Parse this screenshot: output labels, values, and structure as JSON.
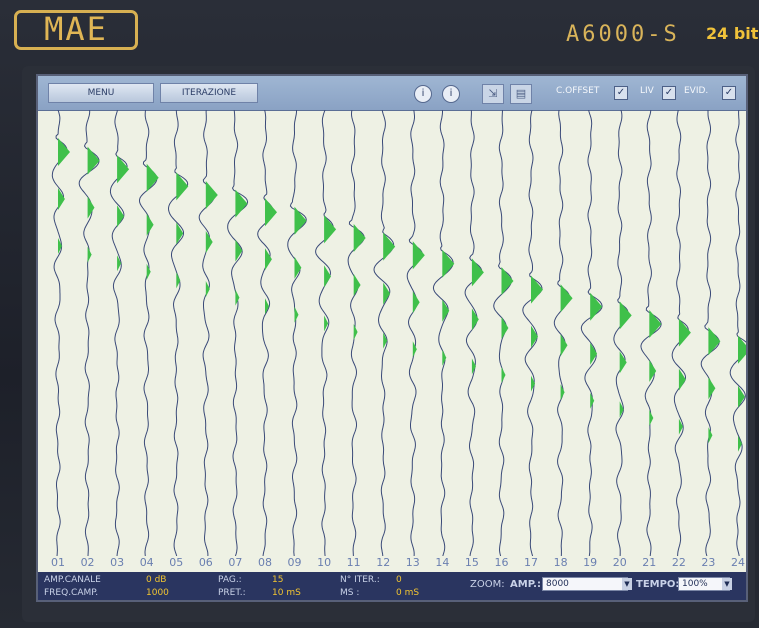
{
  "device": {
    "brand": "MAE",
    "model": "A6000-S",
    "bits": "24 bit"
  },
  "toolbar": {
    "menu_label": "MENU",
    "iterazione_label": "ITERAZIONE",
    "c_offset_label": "C.OFFSET",
    "liv_label": "LIV",
    "evid_label": "EVID."
  },
  "channels": [
    "01",
    "02",
    "03",
    "04",
    "05",
    "06",
    "07",
    "08",
    "09",
    "10",
    "11",
    "12",
    "13",
    "14",
    "15",
    "16",
    "17",
    "18",
    "19",
    "20",
    "21",
    "22",
    "23",
    "24"
  ],
  "status": {
    "amp_canale_label": "AMP.CANALE",
    "amp_canale_value": "0 dB",
    "freq_camp_label": "FREQ.CAMP.",
    "freq_camp_value": "1000",
    "pag_label": "PAG.:",
    "pag_value": "15",
    "pret_label": "PRET.:",
    "pret_value": "10 mS",
    "n_iter_label": "N° ITER.:",
    "n_iter_value": "0",
    "ms_label": "MS   :",
    "ms_value": "0 mS",
    "zoom_label": "ZOOM:",
    "amp_label": "AMP.:",
    "amp_value": "8000",
    "tempo_label": "TEMPO:",
    "tempo_value": "100%"
  },
  "colors": {
    "screen_bg": "#eef1e4",
    "trace": "#3a4a78",
    "fill": "#3fc04a",
    "status_bar": "#2a3560",
    "status_value": "#f2c531",
    "logo": "#d7b052"
  }
}
